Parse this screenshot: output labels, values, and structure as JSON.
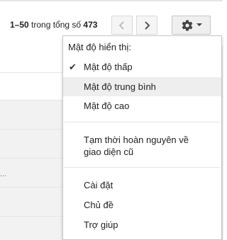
{
  "pagination": {
    "range": "1–50",
    "middle": " trong tổng số ",
    "total": "473"
  },
  "toolbar": {
    "prev_icon": "chevron-left-icon",
    "next_icon": "chevron-right-icon",
    "settings_icon": "gear-icon",
    "dropdown_icon": "caret-down-icon"
  },
  "background": {
    "ellipsis": "..."
  },
  "menu": {
    "density_header": "Mật độ hiển thị:",
    "density_options": [
      {
        "label": "Mật độ thấp",
        "checked": true
      },
      {
        "label": "Mật độ trung bình",
        "checked": false
      },
      {
        "label": "Mật độ cao",
        "checked": false
      }
    ],
    "revert_line1": "Tạm thời hoàn nguyên về",
    "revert_line2": "giao diện cũ",
    "settings": "Cài đặt",
    "themes": "Chủ đề",
    "help": "Trợ giúp"
  },
  "colors": {
    "hover_bg": "#eeeeee",
    "border": "#c8c8c8"
  }
}
